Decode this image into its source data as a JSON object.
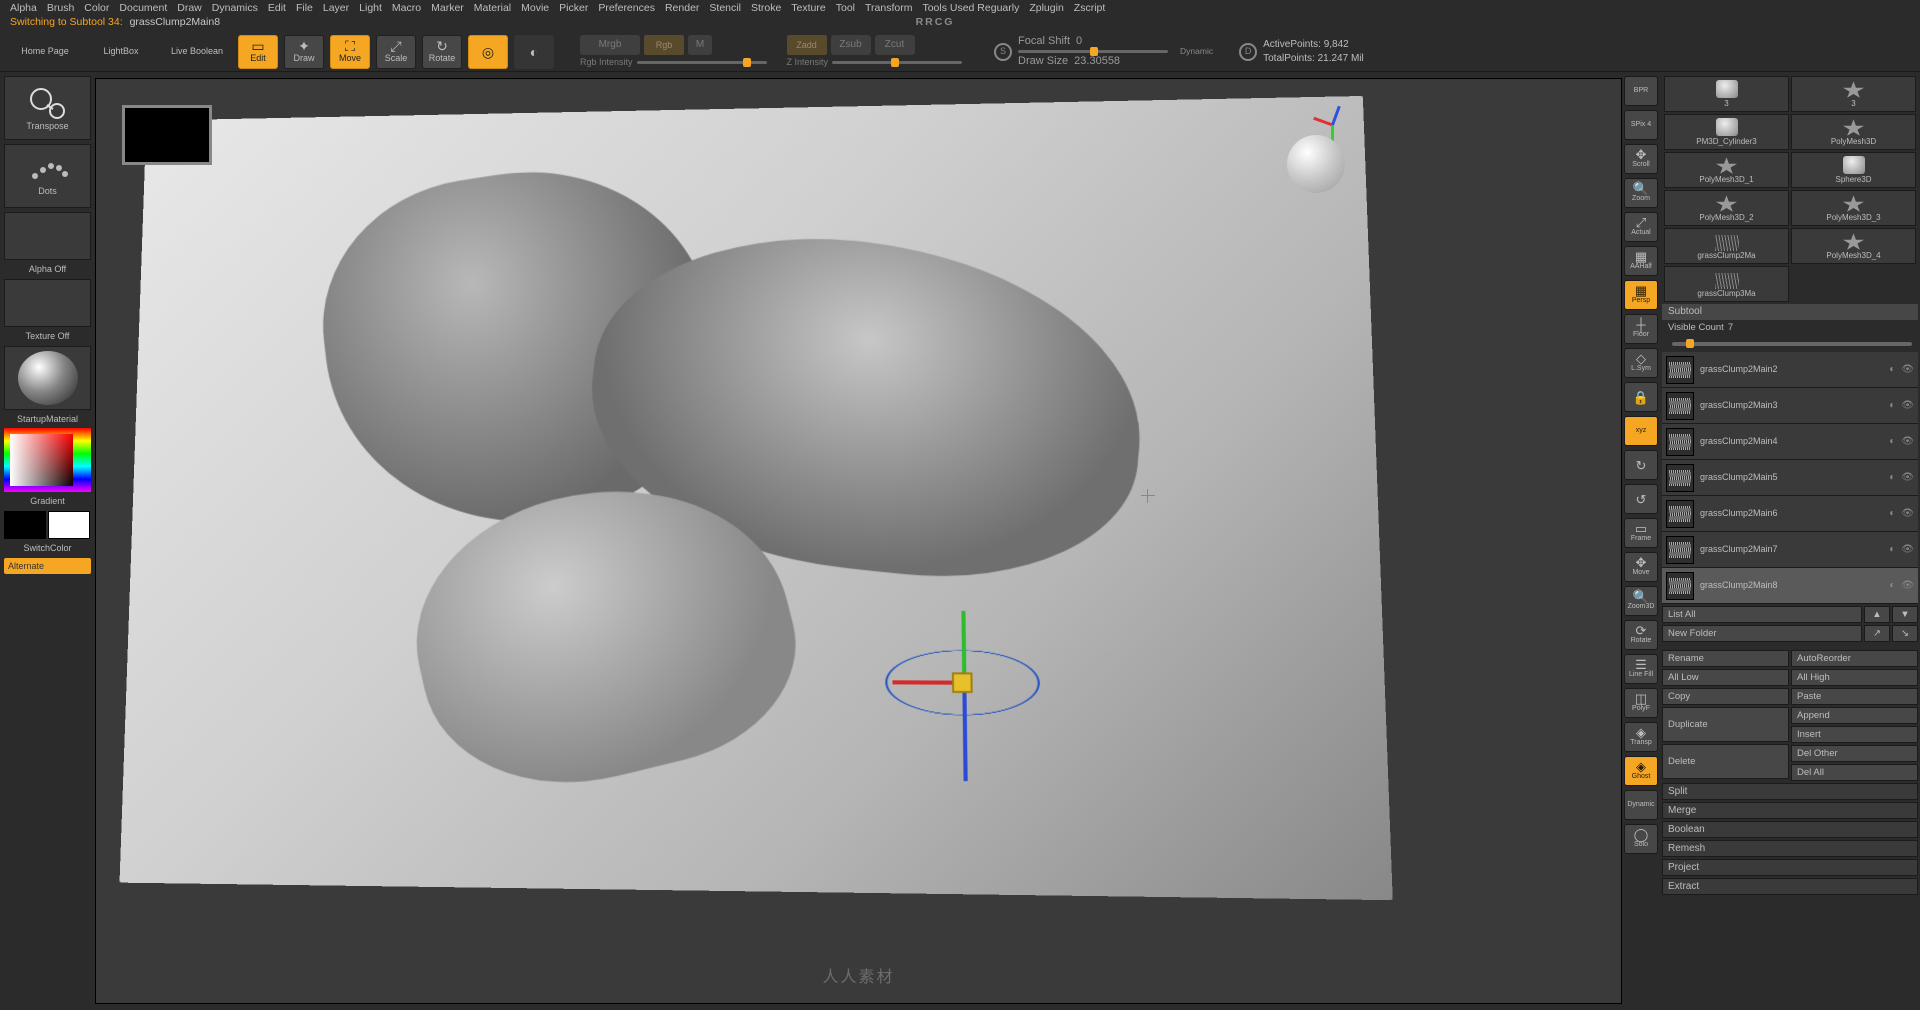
{
  "menubar": [
    "Alpha",
    "Brush",
    "Color",
    "Document",
    "Draw",
    "Dynamics",
    "Edit",
    "File",
    "Layer",
    "Light",
    "Macro",
    "Marker",
    "Material",
    "Movie",
    "Picker",
    "Preferences",
    "Render",
    "Stencil",
    "Stroke",
    "Texture",
    "Tool",
    "Transform",
    "Tools Used Reguarly",
    "Zplugin",
    "Zscript"
  ],
  "status": {
    "left_prefix": "Switching to Subtool 34:",
    "left_name": "grassClump2Main8",
    "title": "RRCG"
  },
  "toolbar": {
    "home": "Home Page",
    "lightbox": "LightBox",
    "liveboolean": "Live Boolean",
    "edit": "Edit",
    "draw": "Draw",
    "move": "Move",
    "scale": "Scale",
    "rotate": "Rotate",
    "mrgb": "Mrgb",
    "rgb": "Rgb",
    "m": "M",
    "rgbintensity": "Rgb Intensity",
    "zadd": "Zadd",
    "zsub": "Zsub",
    "zcut": "Zcut",
    "zintensity": "Z Intensity",
    "focal_label": "Focal Shift",
    "focal_val": "0",
    "drawsize_label": "Draw Size",
    "drawsize_val": "23.30558",
    "dynamic": "Dynamic",
    "activepts_label": "ActivePoints:",
    "activepts_val": "9,842",
    "totalpts_label": "TotalPoints:",
    "totalpts_val": "21.247 Mil"
  },
  "left": {
    "transpose": "Transpose",
    "dots": "Dots",
    "alphaoff": "Alpha Off",
    "textureoff": "Texture Off",
    "startupmat": "StartupMaterial",
    "gradient": "Gradient",
    "switchcolor": "SwitchColor",
    "alternate": "Alternate"
  },
  "viewtools": [
    {
      "id": "bpr",
      "label": "BPR",
      "accent": false
    },
    {
      "id": "spix",
      "label": "SPix 4",
      "accent": false
    },
    {
      "id": "scroll",
      "label": "Scroll",
      "glyph": "✥"
    },
    {
      "id": "zoom",
      "label": "Zoom",
      "glyph": "🔍"
    },
    {
      "id": "actual",
      "label": "Actual",
      "glyph": "⤢"
    },
    {
      "id": "aahalf",
      "label": "AAHalf",
      "glyph": "▦"
    },
    {
      "id": "persp",
      "label": "Persp",
      "accent": true,
      "glyph": "▦"
    },
    {
      "id": "floor",
      "label": "Floor",
      "glyph": "┼"
    },
    {
      "id": "lsym",
      "label": "L.Sym",
      "glyph": "◇"
    },
    {
      "id": "lock",
      "label": "",
      "glyph": "🔒"
    },
    {
      "id": "xyz",
      "label": "xyz",
      "accent": true
    },
    {
      "id": "spin1",
      "label": "",
      "glyph": "↻"
    },
    {
      "id": "spin2",
      "label": "",
      "glyph": "↺"
    },
    {
      "id": "frame",
      "label": "Frame",
      "glyph": "▭"
    },
    {
      "id": "move",
      "label": "Move",
      "glyph": "✥"
    },
    {
      "id": "zoom3d",
      "label": "Zoom3D",
      "glyph": "🔍"
    },
    {
      "id": "rotate",
      "label": "Rotate",
      "glyph": "⟳"
    },
    {
      "id": "linefill",
      "label": "Line Fill",
      "glyph": "☰"
    },
    {
      "id": "polyf",
      "label": "PolyF",
      "glyph": "◫"
    },
    {
      "id": "transp",
      "label": "Transp",
      "glyph": "◈"
    },
    {
      "id": "ghost",
      "label": "Ghost",
      "accent": true,
      "glyph": "◈"
    },
    {
      "id": "dynamic",
      "label": "Dynamic",
      "glyph": ""
    },
    {
      "id": "solo",
      "label": "Solo",
      "glyph": "◯"
    }
  ],
  "tools": [
    {
      "name": "3",
      "shape": "shape"
    },
    {
      "name": "3",
      "shape": "star"
    },
    {
      "name": "PM3D_Cylinder3",
      "shape": "shape"
    },
    {
      "name": "PolyMesh3D",
      "shape": "star"
    },
    {
      "name": "PolyMesh3D_1",
      "shape": "star"
    },
    {
      "name": "Sphere3D",
      "shape": "shape"
    },
    {
      "name": "PolyMesh3D_2",
      "shape": "star"
    },
    {
      "name": "PolyMesh3D_3",
      "shape": "star"
    },
    {
      "name": "grassClump2Ma",
      "shape": "clump"
    },
    {
      "name": "PolyMesh3D_4",
      "shape": "star"
    },
    {
      "name": "grassClump3Ma",
      "shape": "clump"
    }
  ],
  "subtool": {
    "hdr": "Subtool",
    "visible_label": "Visible Count",
    "visible_val": "7",
    "items": [
      {
        "name": "grassClump2Main2"
      },
      {
        "name": "grassClump2Main3"
      },
      {
        "name": "grassClump2Main4"
      },
      {
        "name": "grassClump2Main5"
      },
      {
        "name": "grassClump2Main6"
      },
      {
        "name": "grassClump2Main7"
      },
      {
        "name": "grassClump2Main8",
        "sel": true
      }
    ],
    "listall": "List All",
    "newfolder": "New Folder",
    "rename": "Rename",
    "autoreorder": "AutoReorder",
    "alllow": "All Low",
    "allhigh": "All High",
    "copy": "Copy",
    "paste": "Paste",
    "duplicate": "Duplicate",
    "append": "Append",
    "insert": "Insert",
    "delete": "Delete",
    "delother": "Del Other",
    "delall": "Del All",
    "split": "Split",
    "merge": "Merge",
    "boolean": "Boolean",
    "remesh": "Remesh",
    "project": "Project",
    "extract": "Extract"
  },
  "watermark": "人人素材"
}
